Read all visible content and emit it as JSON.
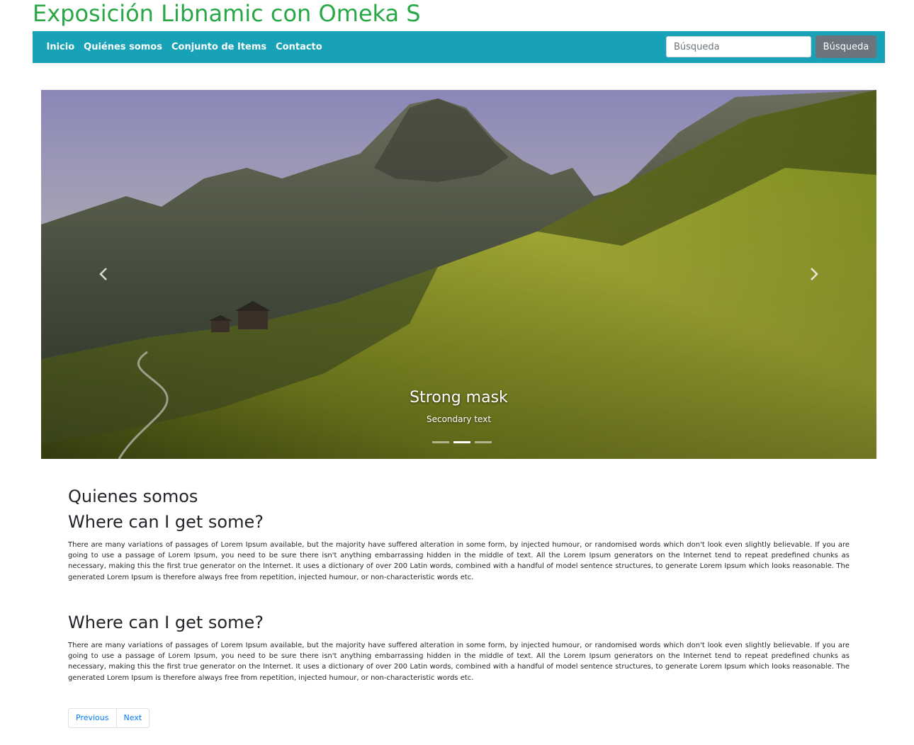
{
  "site": {
    "title": "Exposición Libnamic con Omeka S"
  },
  "nav": {
    "items": [
      {
        "label": "Inicio"
      },
      {
        "label": "Quiénes somos"
      },
      {
        "label": "Conjunto de Items"
      },
      {
        "label": "Contacto"
      }
    ],
    "search_placeholder": "Búsqueda",
    "search_button": "Búsqueda"
  },
  "carousel": {
    "caption_title": "Strong mask",
    "caption_text": "Secondary text",
    "indicator_count": 3,
    "active_indicator": 2,
    "prev_icon": "chevron-left-icon",
    "next_icon": "chevron-right-icon"
  },
  "page": {
    "heading": "Quienes somos",
    "sections": [
      {
        "title": "Where can I get some?",
        "body": "There are many variations of passages of Lorem Ipsum available, but the majority have suffered alteration in some form, by injected humour, or randomised words which don't look even slightly believable. If you are going to use a passage of Lorem Ipsum, you need to be sure there isn't anything embarrassing hidden in the middle of text. All the Lorem Ipsum generators on the Internet tend to repeat predefined chunks as necessary, making this the first true generator on the Internet. It uses a dictionary of over 200 Latin words, combined with a handful of model sentence structures, to generate Lorem Ipsum which looks reasonable. The generated Lorem Ipsum is therefore always free from repetition, injected humour, or non-characteristic words etc."
      },
      {
        "title": "Where can I get some?",
        "body": "There are many variations of passages of Lorem Ipsum available, but the majority have suffered alteration in some form, by injected humour, or randomised words which don't look even slightly believable. If you are going to use a passage of Lorem Ipsum, you need to be sure there isn't anything embarrassing hidden in the middle of text. All the Lorem Ipsum generators on the Internet tend to repeat predefined chunks as necessary, making this the first true generator on the Internet. It uses a dictionary of over 200 Latin words, combined with a handful of model sentence structures, to generate Lorem Ipsum which looks reasonable. The generated Lorem Ipsum is therefore always free from repetition, injected humour, or non-characteristic words etc."
      }
    ]
  },
  "pagination": {
    "previous": "Previous",
    "next": "Next"
  },
  "colors": {
    "title": "#28a745",
    "navbar": "#17a2b8",
    "search_button": "#6c757d",
    "link": "#007bff"
  }
}
